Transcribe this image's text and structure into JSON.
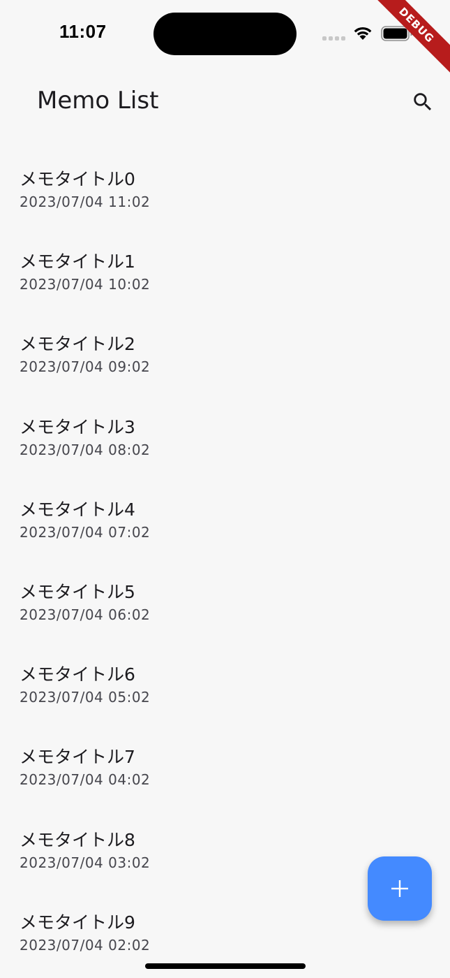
{
  "status_bar": {
    "time": "11:07"
  },
  "debug_banner": {
    "label": "DEBUG"
  },
  "app_bar": {
    "title": "Memo List",
    "search_icon": "search-icon"
  },
  "memos": [
    {
      "title": "メモタイトル0",
      "date": "2023/07/04 11:02"
    },
    {
      "title": "メモタイトル1",
      "date": "2023/07/04 10:02"
    },
    {
      "title": "メモタイトル2",
      "date": "2023/07/04 09:02"
    },
    {
      "title": "メモタイトル3",
      "date": "2023/07/04 08:02"
    },
    {
      "title": "メモタイトル4",
      "date": "2023/07/04 07:02"
    },
    {
      "title": "メモタイトル5",
      "date": "2023/07/04 06:02"
    },
    {
      "title": "メモタイトル6",
      "date": "2023/07/04 05:02"
    },
    {
      "title": "メモタイトル7",
      "date": "2023/07/04 04:02"
    },
    {
      "title": "メモタイトル8",
      "date": "2023/07/04 03:02"
    },
    {
      "title": "メモタイトル9",
      "date": "2023/07/04 02:02"
    }
  ],
  "fab": {
    "icon": "plus-icon"
  },
  "colors": {
    "background": "#f7f7f7",
    "fab": "#448aff",
    "debug_ribbon": "#b71c1c",
    "text_primary": "#1c1b1f",
    "text_secondary": "#46464d"
  }
}
